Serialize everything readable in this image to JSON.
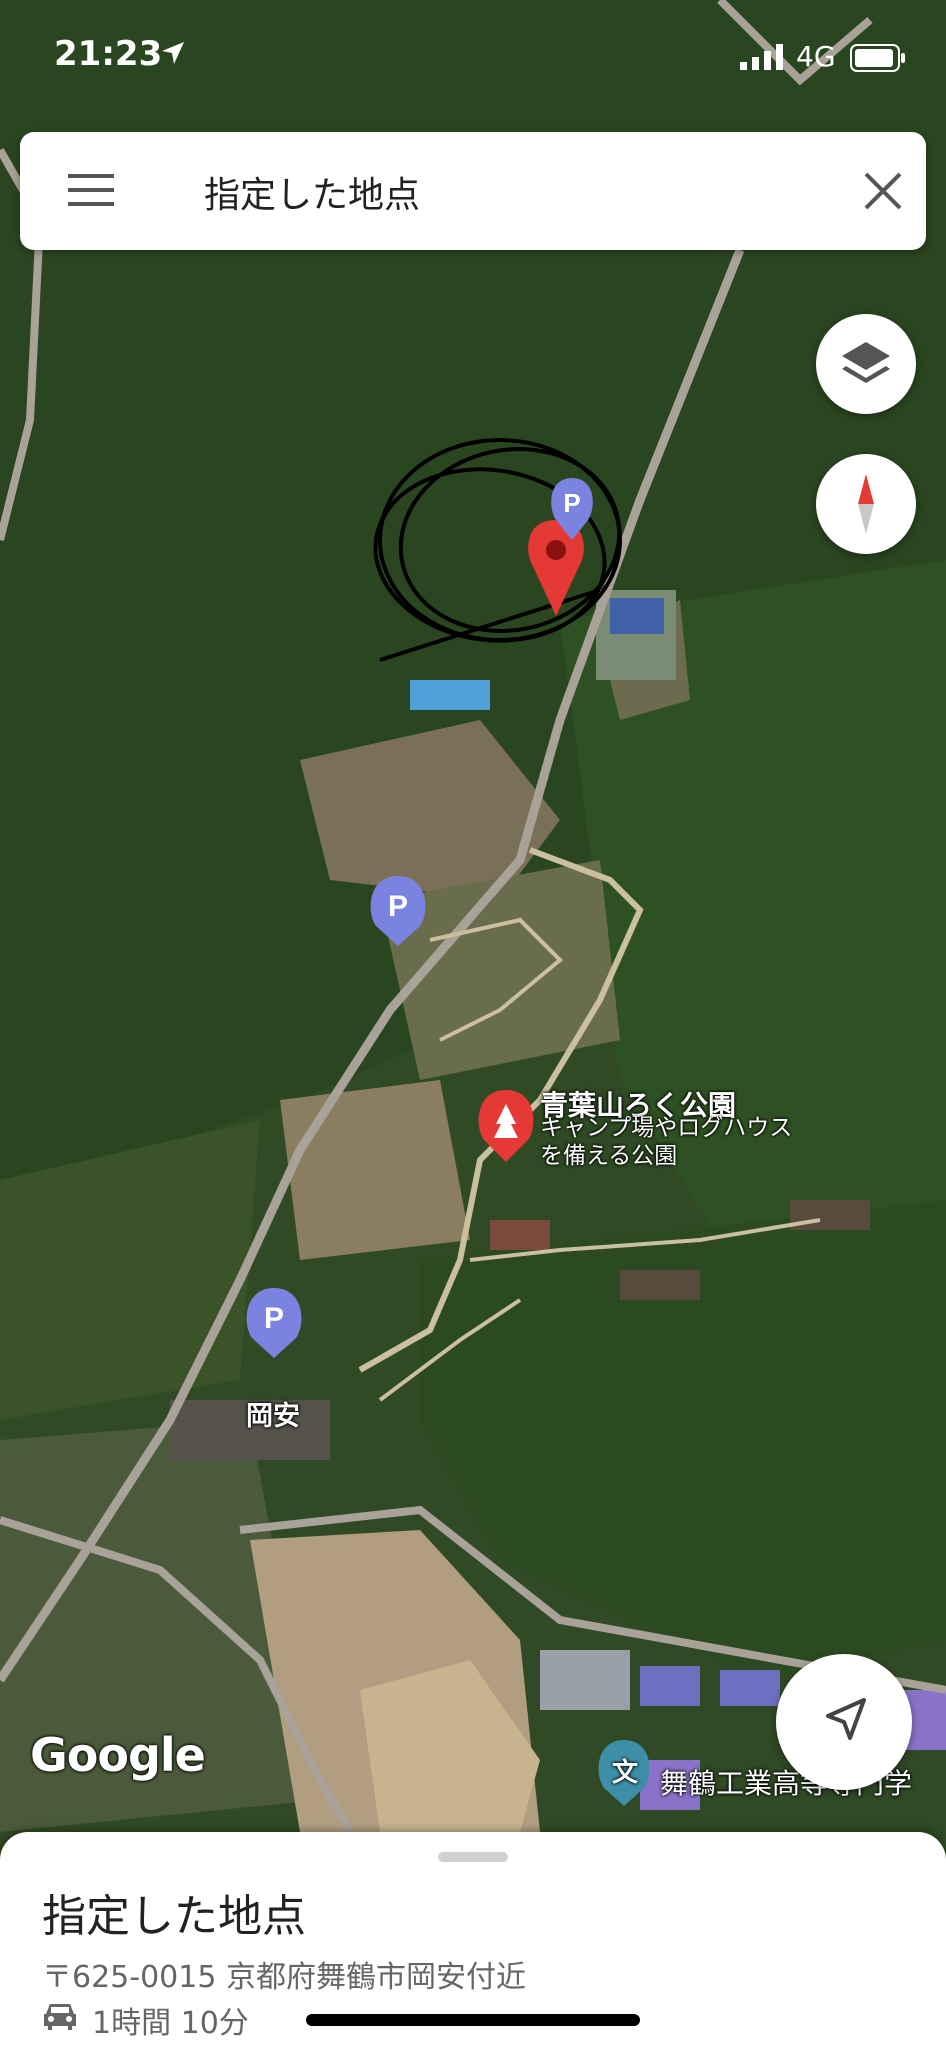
{
  "status_bar": {
    "time": "21:23",
    "network": "4G"
  },
  "search": {
    "title": "指定した地点"
  },
  "map": {
    "park": {
      "name": "青葉山ろく公園",
      "desc_line1": "キャンプ場やログハウス",
      "desc_line2": "を備える公園"
    },
    "town_label": "岡安",
    "school_label": "舞鶴工業高等専門学",
    "school_icon": "文",
    "parking_icon": "P",
    "attribution": "Google"
  },
  "sheet": {
    "place": "指定した地点",
    "address": "〒625-0015 京都府舞鶴市岡安付近",
    "eta": "1時間 10分"
  },
  "colors": {
    "pin_red": "#e53935",
    "parking_purple": "#7b83e0",
    "accent": "#1a73e8"
  }
}
